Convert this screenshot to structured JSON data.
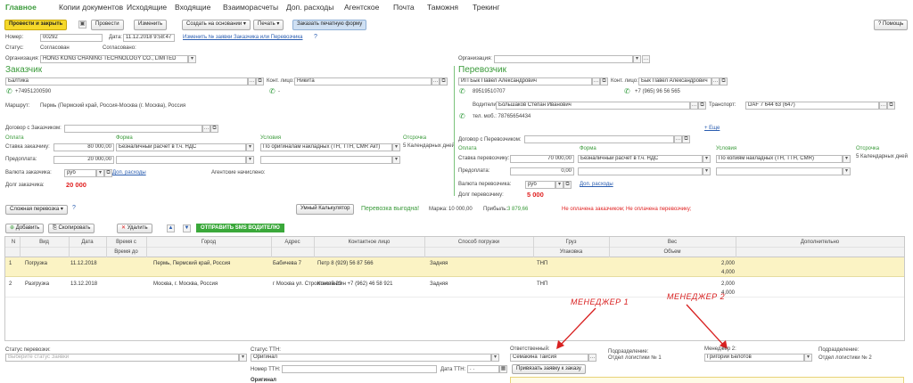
{
  "menu": [
    "Главное",
    "Копии документов",
    "Исходящие",
    "Входящие",
    "Взаиморасчеты",
    "Доп. расходы",
    "Агентское",
    "Почта",
    "Таможня",
    "Трекинг"
  ],
  "toolbar": {
    "post_close": "Провести и закрыть",
    "post": "Провести",
    "edit": "Изменить",
    "create_based": "Создать на основании",
    "print": "Печать",
    "order_print": "Заказать печатную форму",
    "help": "Помощь"
  },
  "header": {
    "number_label": "Номер:",
    "number": "00292",
    "date_label": "Дата:",
    "date": "11.12.2018 9:58:47",
    "change_link": "Изменить № заявки Заказчика или Перевозчика",
    "q": "?",
    "status_label": "Статус:",
    "status": "Согласован",
    "agreed_label": "Согласовано:",
    "org_label": "Организация:",
    "org": "HONG KONG CHANING TECHNOLOGY CO., LIMITED",
    "org2_label": "Организация:"
  },
  "customer": {
    "title": "Заказчик",
    "name": "Балтика",
    "contact_label": "Конт. лицо:",
    "contact": "Никита",
    "phone": "+74951200590",
    "phone2": "-",
    "route_label": "Маршрут:",
    "route": "Пермь (Пермский край, Россия-Москва (г. Москва), Россия",
    "contract_label": "Договор с Заказчиком:",
    "pay_head": "Оплата",
    "form_head": "Форма",
    "cond_head": "Условия",
    "delay_head": "Отсрочка",
    "rate_label": "Ставка заказчику:",
    "rate": "80 000,00",
    "form": "Безналичный расчет в т.ч. НДС",
    "cond": "По оригиналам накладных (ТН, ТТН, CMR Акт)",
    "delay": "5 Календарных дней",
    "prepay_label": "Предоплата:",
    "prepay": "20 000,00",
    "currency_label": "Валюта заказчика:",
    "currency": "руб",
    "extra_link": "Доп. расходы",
    "agent_label": "Агентские начислено:",
    "debt_label": "Долг заказчика:",
    "debt": "20 000"
  },
  "carrier": {
    "title": "Перевозчик",
    "name": "ИП Бык Павел Александрович",
    "contact_label": "Конт. лицо:",
    "contact": "Бык Павел Александрович",
    "phone": "89519510707",
    "phone2": "+7 (965) 96 56 565",
    "drivers_label": "Водители:",
    "driver": "Большаков Степан Иванович",
    "transport_label": "Транспорт:",
    "transport": "DAF 7 644 63 (647)",
    "mob": "тел. моб.: 78765654434",
    "more_link": "+ Еще",
    "contract_label": "Договор с Перевозчиком:",
    "pay_head": "Оплата",
    "form_head": "Форма",
    "cond_head": "Условия",
    "delay_head": "Отсрочка",
    "rate_label": "Ставка перевозчику:",
    "rate": "70 000,00",
    "form": "Безналичный расчет в т.ч. НДС",
    "cond": "По копиям накладных (ТН, ТТН, CMR)",
    "delay": "5 Календарных дней",
    "prepay_label": "Предоплата:",
    "prepay": "0,00",
    "currency_label": "Валюта перевозчика:",
    "currency": "руб",
    "extra_link": "Доп. расходы",
    "debt_label": "Долг перевозчику:",
    "debt": "5 000"
  },
  "profit_bar": {
    "complex": "Сложная перевозка",
    "q": "?",
    "calc": "Умный Калькулятор",
    "profit_text": "Перевозка выгодна!",
    "margin_label": "Маржа:",
    "margin": "10 000,00",
    "profit_label": "Прибыль:",
    "profit": "3 879,66",
    "unpaid": "Не оплачена заказчиком; Не оплачена перевозчику;"
  },
  "grid_toolbar": {
    "add": "Добавить",
    "copy": "Скопировать",
    "delete": "Удалить",
    "sms": "ОТПРАВИТЬ SMS ВОДИТЕЛЮ"
  },
  "grid": {
    "headers": {
      "n": "N",
      "kind": "Вид",
      "date": "Дата",
      "time_from": "Время с",
      "time_to": "Время до",
      "city": "Город",
      "address": "Адрес",
      "contact": "Контактное лицо",
      "method": "Способ погрузки",
      "cargo": "Груз",
      "pack": "Упаковка",
      "weight": "Вес",
      "volume": "Объем",
      "extra": "Дополнительно"
    },
    "rows": [
      {
        "n": "1",
        "kind": "Погрузка",
        "date": "11.12.2018",
        "city": "Пермь, Пермский край, Россия",
        "address": "Бабичева 7",
        "contact": "Петр 8 (929) 56 87 566",
        "method": "Задняя",
        "cargo": "ТНП",
        "weight": "2,000",
        "volume": "4,000"
      },
      {
        "n": "2",
        "kind": "Разгрузка",
        "date": "13.12.2018",
        "city": "Москва, г. Москва, Россия",
        "address": "г Москва ул. Строителей 23",
        "contact": "Константин +7 (962) 46 58 921",
        "method": "Задняя",
        "cargo": "ТНП",
        "weight": "2,000",
        "volume": "4,000"
      }
    ]
  },
  "annotations": {
    "m1": "МЕНЕДЖЕР 1",
    "m2": "МЕНЕДЖЕР 2"
  },
  "bottom": {
    "status_label": "Статус перевозки:",
    "status_placeholder": "Выберите статус Заявки",
    "ttn_status_label": "Статус ТТН:",
    "ttn_status": "Оригинал",
    "ttn_num_label": "Номер ТТН:",
    "ttn_date_label": "Дата ТТН:",
    "ttn_date": ". .",
    "bind_btn": "Привязать заявку к заказу",
    "resp_label": "Ответственный:",
    "resp": "Семакина Таисия",
    "dept_label": "Подразделение:",
    "dept": "Отдел логистики № 1",
    "mgr2_label": "Менеджер 2:",
    "mgr2": "Григорий Белотов",
    "dept2_label": "Подразделение:",
    "dept2": "Отдел логистики № 2",
    "original": "Оригинал"
  }
}
